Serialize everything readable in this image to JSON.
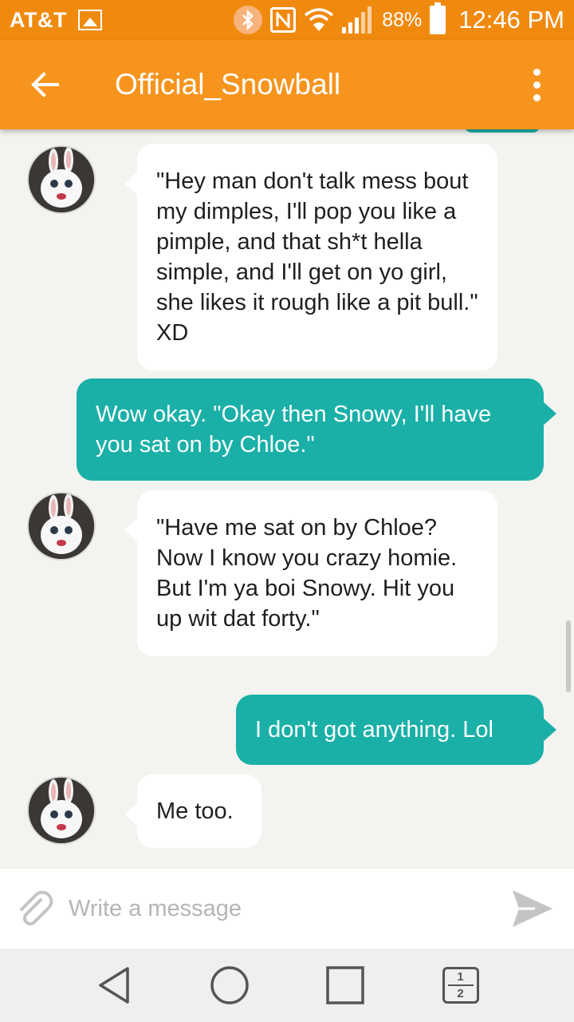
{
  "status_bar": {
    "carrier": "AT&T",
    "battery_percent": "88%",
    "time": "12:46 PM",
    "icons": [
      "image-icon",
      "bluetooth-icon",
      "nfc-icon",
      "wifi-icon",
      "signal-icon",
      "battery-icon"
    ]
  },
  "header": {
    "title": "Official_Snowball",
    "back_icon": "arrow-left-icon",
    "menu_icon": "more-vert-icon"
  },
  "messages": [
    {
      "from": "Official_Snowball",
      "direction": "incoming",
      "text": "\"Hey man don't talk mess bout my dimples, I'll pop you like a pimple, and that sh*t hella simple, and I'll get on yo girl, she likes it rough like a pit bull.\" XD"
    },
    {
      "from": "me",
      "direction": "outgoing",
      "text": "Wow okay. \"Okay then Snowy, I'll have you sat on by Chloe.\""
    },
    {
      "from": "Official_Snowball",
      "direction": "incoming",
      "text": "\"Have me sat on by Chloe? Now I know you crazy homie. But I'm ya boi Snowy. Hit you up wit dat forty.\""
    },
    {
      "from": "me",
      "direction": "outgoing",
      "text": "I don't got anything. Lol"
    },
    {
      "from": "Official_Snowball",
      "direction": "incoming",
      "text": "Me too."
    }
  ],
  "composer": {
    "placeholder": "Write a message",
    "value": "",
    "attach_icon": "paperclip-icon",
    "send_icon": "send-icon"
  },
  "nav_bar": {
    "icons": [
      "back-triangle-icon",
      "home-circle-icon",
      "recents-square-icon",
      "dual-window-icon"
    ],
    "dual_window_top": "1",
    "dual_window_bottom": "2"
  },
  "colors": {
    "status_bar": "#f08a0f",
    "app_bar": "#f7941d",
    "outgoing_bubble": "#1ab0a8",
    "incoming_bubble": "#ffffff",
    "chat_background": "#f3f3ef"
  }
}
